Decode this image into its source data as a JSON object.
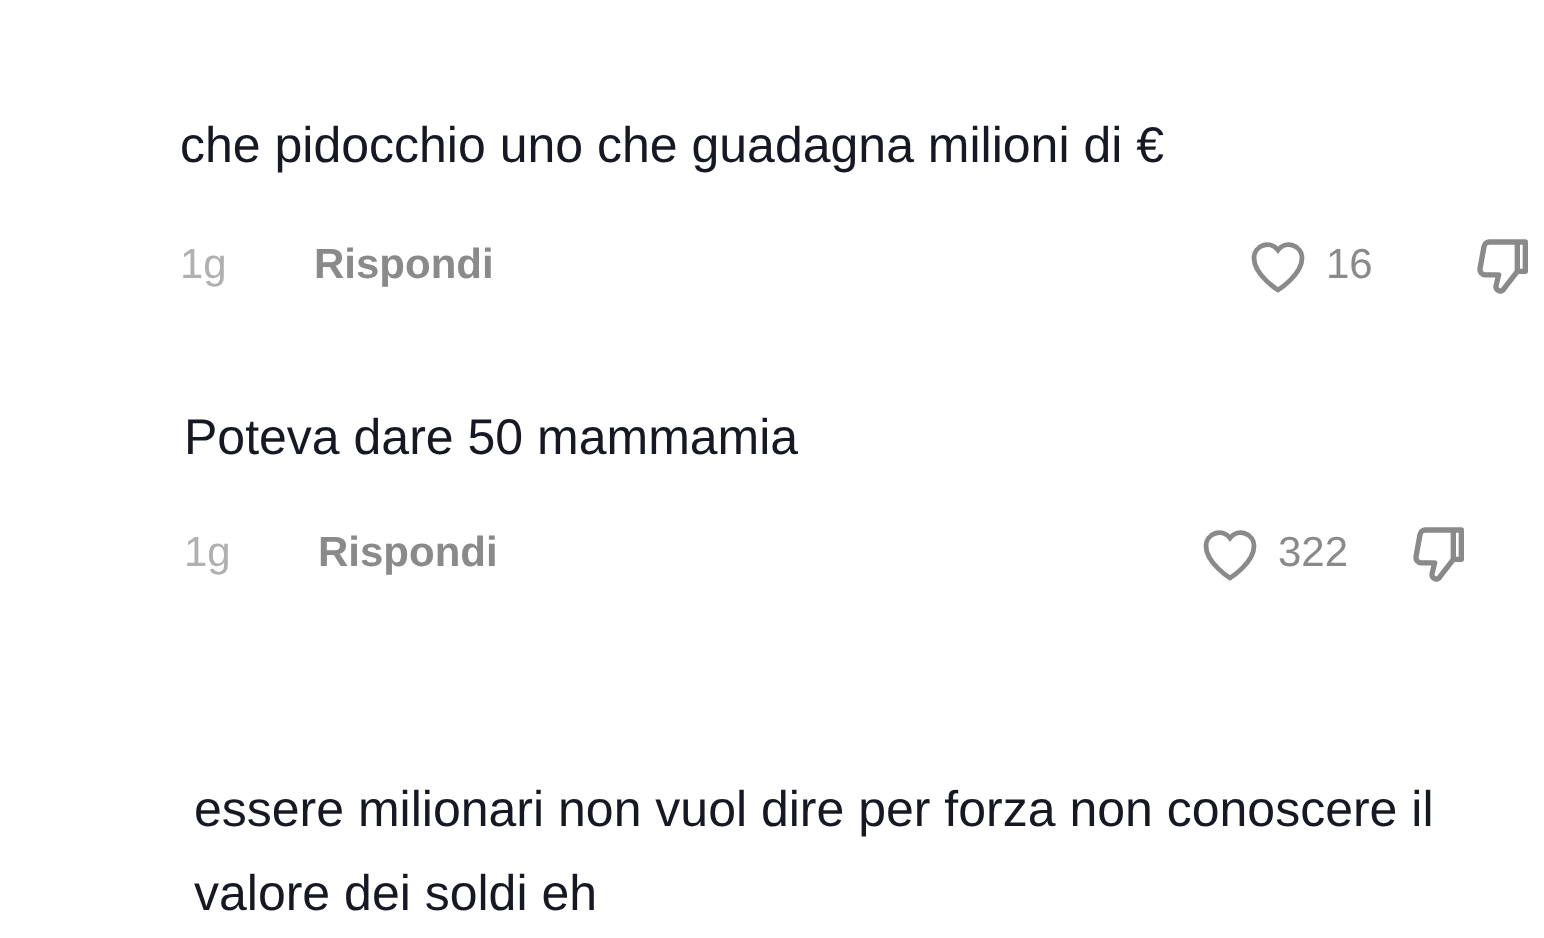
{
  "comments": [
    {
      "text": "che pidocchio uno che guadagna milioni di €",
      "time": "1g",
      "reply": "Rispondi",
      "likes": "16"
    },
    {
      "text": "Poteva dare 50 mammamia",
      "time": "1g",
      "reply": "Rispondi",
      "likes": "322"
    },
    {
      "text": "essere milionari non vuol dire per forza non conoscere il valore dei soldi eh"
    }
  ]
}
